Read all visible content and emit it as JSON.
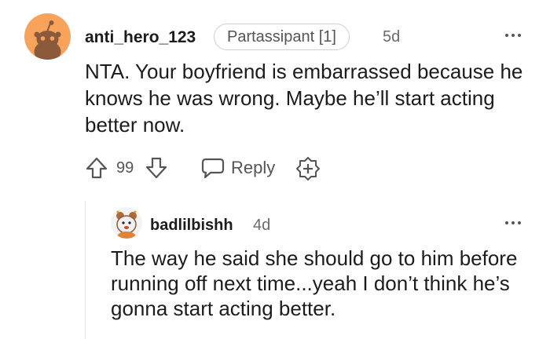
{
  "comment": {
    "username": "anti_hero_123",
    "flair": "Partassipant [1]",
    "time": "5d",
    "body": "NTA. Your boyfriend is embarrassed because he knows he was wrong. Maybe he’ll start acting better now.",
    "score": "99",
    "reply_label": "Reply"
  },
  "reply": {
    "username": "badlilbishh",
    "time": "4d",
    "body": "The way he said she should go to him before running off next time...yeah I don’t think he’s gonna start acting better."
  },
  "icons": [
    "snoo-avatar-icon",
    "more-options-icon",
    "upvote-icon",
    "downvote-icon",
    "reply-icon",
    "award-icon"
  ],
  "colors": {
    "avatar_bg": "#f7a35c",
    "text": "#1c1c1c",
    "muted": "#6a6a6a"
  }
}
